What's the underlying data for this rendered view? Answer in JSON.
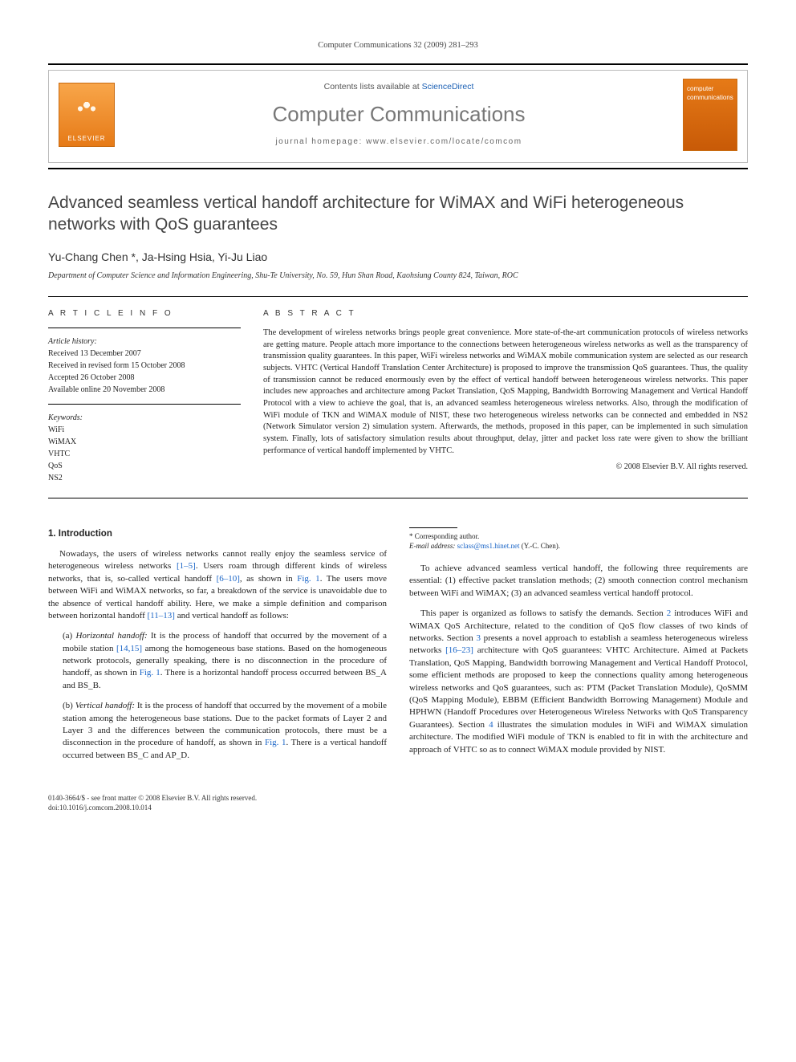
{
  "header": {
    "citation": "Computer Communications 32 (2009) 281–293"
  },
  "banner": {
    "publisher_logo_text": "ELSEVIER",
    "contents_prefix": "Contents lists available at ",
    "contents_link": "ScienceDirect",
    "journal_title": "Computer Communications",
    "homepage_label": "journal homepage: ",
    "homepage_url": "www.elsevier.com/locate/comcom",
    "cover_top": "computer",
    "cover_bottom": "communications"
  },
  "article": {
    "title": "Advanced seamless vertical handoff architecture for WiMAX and WiFi heterogeneous networks with QoS guarantees",
    "authors": "Yu-Chang Chen *, Ja-Hsing Hsia, Yi-Ju Liao",
    "affiliation": "Department of Computer Science and Information Engineering, Shu-Te University, No. 59, Hun Shan Road, Kaohsiung County 824, Taiwan, ROC"
  },
  "info": {
    "heading": "A R T I C L E   I N F O",
    "history_label": "Article history:",
    "history": {
      "received": "Received 13 December 2007",
      "revised": "Received in revised form 15 October 2008",
      "accepted": "Accepted 26 October 2008",
      "online": "Available online 20 November 2008"
    },
    "keywords_label": "Keywords:",
    "keywords": [
      "WiFi",
      "WiMAX",
      "VHTC",
      "QoS",
      "NS2"
    ]
  },
  "abstract": {
    "heading": "A B S T R A C T",
    "text": "The development of wireless networks brings people great convenience. More state-of-the-art communication protocols of wireless networks are getting mature. People attach more importance to the connections between heterogeneous wireless networks as well as the transparency of transmission quality guarantees. In this paper, WiFi wireless networks and WiMAX mobile communication system are selected as our research subjects. VHTC (Vertical Handoff Translation Center Architecture) is proposed to improve the transmission QoS guarantees. Thus, the quality of transmission cannot be reduced enormously even by the effect of vertical handoff between heterogeneous wireless networks. This paper includes new approaches and architecture among Packet Translation, QoS Mapping, Bandwidth Borrowing Management and Vertical Handoff Protocol with a view to achieve the goal, that is, an advanced seamless heterogeneous wireless networks. Also, through the modification of WiFi module of TKN and WiMAX module of NIST, these two heterogeneous wireless networks can be connected and embedded in NS2 (Network Simulator version 2) simulation system. Afterwards, the methods, proposed in this paper, can be implemented in such simulation system. Finally, lots of satisfactory simulation results about throughput, delay, jitter and packet loss rate were given to show the brilliant performance of vertical handoff implemented by VHTC.",
    "copyright": "© 2008 Elsevier B.V. All rights reserved."
  },
  "body": {
    "section1_heading": "1. Introduction",
    "p1_a": "Nowadays, the users of wireless networks cannot really enjoy the seamless service of heterogeneous wireless networks ",
    "p1_ref1": "[1–5]",
    "p1_b": ". Users roam through different kinds of wireless networks, that is, so-called vertical handoff ",
    "p1_ref2": "[6–10]",
    "p1_c": ", as shown in ",
    "p1_fig": "Fig. 1",
    "p1_d": ". The users move between WiFi and WiMAX networks, so far, a breakdown of the service is unavoidable due to the absence of vertical handoff ability. Here, we make a simple definition and comparison between horizontal handoff ",
    "p1_ref3": "[11–13]",
    "p1_e": " and vertical handoff as follows:",
    "item_a_tag": "(a) ",
    "item_a_term": "Horizontal handoff: ",
    "item_a_text_a": "It is the process of handoff that occurred by the movement of a mobile station ",
    "item_a_ref": "[14,15]",
    "item_a_text_b": " among the homogeneous base stations. Based on the homogeneous network protocols, generally speaking, there is no disconnection in the procedure of handoff, as shown in ",
    "item_a_fig": "Fig. 1",
    "item_a_text_c": ". There is a horizontal handoff process occurred between BS_A and BS_B.",
    "item_b_tag": "(b) ",
    "item_b_term": "Vertical handoff: ",
    "item_b_text_a": "It is the process of handoff that occurred by the movement of a mobile station among the heterogeneous base stations. Due to the packet formats of Layer 2 and Layer 3 and the differences between the communication protocols, ",
    "item_b_text_b": "there must be a disconnection in the procedure of handoff, as shown in ",
    "item_b_fig": "Fig. 1",
    "item_b_text_c": ". There is a vertical handoff occurred between BS_C and AP_D.",
    "p2": "To achieve advanced seamless vertical handoff, the following three requirements are essential: (1) effective packet translation methods; (2) smooth connection control mechanism between WiFi and WiMAX; (3) an advanced seamless vertical handoff protocol.",
    "p3_a": "This paper is organized as follows to satisfy the demands. Section ",
    "p3_s2": "2",
    "p3_b": " introduces WiFi and WiMAX QoS Architecture, related to the condition of QoS flow classes of two kinds of networks. Section ",
    "p3_s3": "3",
    "p3_c": " presents a novel approach to establish a seamless heterogeneous wireless networks ",
    "p3_ref": "[16–23]",
    "p3_d": " architecture with QoS guarantees: VHTC Architecture. Aimed at Packets Translation, QoS Mapping, Bandwidth borrowing Management and Vertical Handoff Protocol, some efficient methods are proposed to keep the connections quality among heterogeneous wireless networks and QoS guarantees, such as: PTM (Packet Translation Module), QoSMM (QoS Mapping Module), EBBM (Efficient Bandwidth Borrowing Management) Module and HPHWN (Handoff Procedures over Heterogeneous Wireless Networks with QoS Transparency Guarantees). Section ",
    "p3_s4": "4",
    "p3_e": " illustrates the simulation modules in WiFi and WiMAX simulation architecture. The modified WiFi module of TKN is enabled to fit in with the architecture and approach of VHTC so as to connect WiMAX module provided by NIST."
  },
  "footnotes": {
    "corr": "* Corresponding author.",
    "email_label": "E-mail address: ",
    "email": "sclass@ms1.hinet.net",
    "email_tail": " (Y.-C. Chen)."
  },
  "bottom": {
    "line1": "0140-3664/$ - see front matter © 2008 Elsevier B.V. All rights reserved.",
    "line2": "doi:10.1016/j.comcom.2008.10.014"
  }
}
